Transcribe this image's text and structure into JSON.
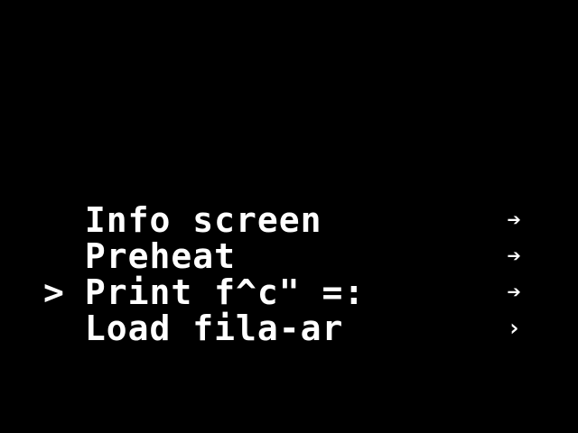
{
  "menu": {
    "cursor_symbol": ">",
    "items": [
      {
        "label": "Info screen",
        "arrow": "➔",
        "selected": false
      },
      {
        "label": "Preheat",
        "arrow": "➔",
        "selected": false
      },
      {
        "label": "Print f^c\" =:",
        "arrow": "➔",
        "selected": true
      },
      {
        "label": "Load fila-ar",
        "arrow": "›",
        "selected": false
      }
    ]
  },
  "colors": {
    "background": "#000000",
    "text": "#ffffff"
  }
}
